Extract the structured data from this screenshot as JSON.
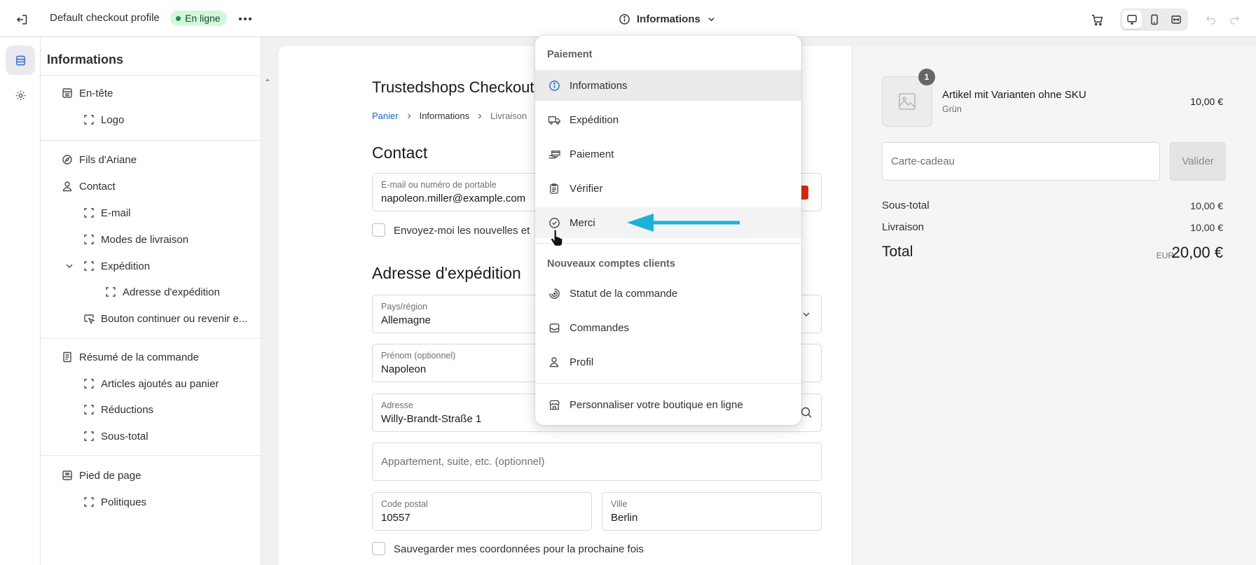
{
  "topbar": {
    "profile_name": "Default checkout profile",
    "status_badge": "En ligne",
    "page_selector": "Informations"
  },
  "sidebar": {
    "title": "Informations",
    "items": [
      {
        "label": "En-tête",
        "icon": "layout-header-icon"
      },
      {
        "label": "Logo",
        "icon": "section-block-icon"
      },
      {
        "label": "Fils d'Ariane",
        "icon": "compass-icon"
      },
      {
        "label": "Contact",
        "icon": "person-icon"
      },
      {
        "label": "E-mail",
        "icon": "section-block-icon"
      },
      {
        "label": "Modes de livraison",
        "icon": "section-block-icon"
      },
      {
        "label": "Expédition",
        "icon": "section-block-icon"
      },
      {
        "label": "Adresse d'expédition",
        "icon": "section-block-icon"
      },
      {
        "label": "Bouton continuer ou revenir e...",
        "icon": "button-cursor-icon"
      },
      {
        "label": "Résumé de la commande",
        "icon": "receipt-icon"
      },
      {
        "label": "Articles ajoutés au panier",
        "icon": "section-block-icon"
      },
      {
        "label": "Réductions",
        "icon": "section-block-icon"
      },
      {
        "label": "Sous-total",
        "icon": "section-block-icon"
      },
      {
        "label": "Pied de page",
        "icon": "layout-footer-icon"
      },
      {
        "label": "Politiques",
        "icon": "section-block-icon"
      }
    ]
  },
  "preview": {
    "shop_title": "Trustedshops Checkout",
    "breadcrumb": [
      "Panier",
      "Informations",
      "Livraison"
    ],
    "contact_heading": "Contact",
    "email_label": "E-mail ou numéro de portable",
    "email_value": "napoleon.miller@example.com",
    "newsletter_label": "Envoyez-moi les nouvelles et",
    "shipping_heading": "Adresse d'expédition",
    "country_label": "Pays/région",
    "country_value": "Allemagne",
    "firstname_label": "Prénom (optionnel)",
    "firstname_value": "Napoleon",
    "address_label": "Adresse",
    "address_value": "Willy-Brandt-Straße 1",
    "apartment_placeholder": "Appartement, suite, etc. (optionnel)",
    "postal_label": "Code postal",
    "postal_value": "10557",
    "city_label": "Ville",
    "city_value": "Berlin",
    "save_info_label": "Sauvegarder mes coordonnées pour la prochaine fois"
  },
  "summary": {
    "quantity": "1",
    "product_name": "Artikel mit Varianten ohne SKU",
    "product_variant": "Grün",
    "product_price": "10,00 €",
    "gift_placeholder": "Carte-cadeau",
    "apply_label": "Valider",
    "subtotal_label": "Sous-total",
    "subtotal_value": "10,00 €",
    "shipping_label": "Livraison",
    "shipping_value": "10,00 €",
    "total_label": "Total",
    "total_currency": "EUR",
    "total_value": "20,00 €"
  },
  "dropdown": {
    "section_checkout": "Paiement",
    "items_checkout": [
      {
        "label": "Informations",
        "icon": "info-icon",
        "state": "selected"
      },
      {
        "label": "Expédition",
        "icon": "truck-icon"
      },
      {
        "label": "Paiement",
        "icon": "hand-card-icon"
      },
      {
        "label": "Vérifier",
        "icon": "clipboard-icon"
      },
      {
        "label": "Merci",
        "icon": "check-circle-icon",
        "state": "hover"
      }
    ],
    "section_accounts": "Nouveaux comptes clients",
    "items_accounts": [
      {
        "label": "Statut de la commande",
        "icon": "order-status-icon"
      },
      {
        "label": "Commandes",
        "icon": "inbox-icon"
      },
      {
        "label": "Profil",
        "icon": "person-icon"
      }
    ],
    "customize_label": "Personnaliser votre boutique en ligne",
    "customize_icon": "store-icon"
  },
  "colors": {
    "accent": "#2c6ecb",
    "arrow": "#1ab2d6",
    "online_badge_bg": "#d4f7d9"
  }
}
